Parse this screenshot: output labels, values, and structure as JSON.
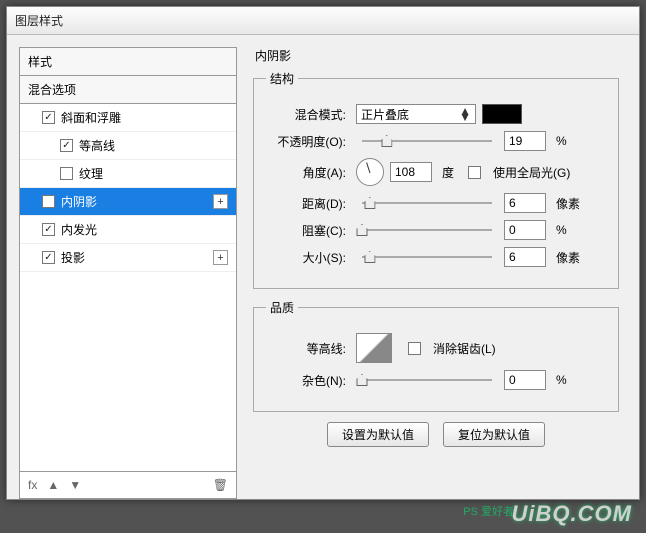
{
  "window": {
    "title": "图层样式"
  },
  "left": {
    "styles_header": "样式",
    "blend_options": "混合选项",
    "items": {
      "bevel": {
        "label": "斜面和浮雕",
        "checked": true
      },
      "contour": {
        "label": "等高线",
        "checked": true
      },
      "texture": {
        "label": "纹理",
        "checked": false
      },
      "inner_shadow": {
        "label": "内阴影",
        "checked": true
      },
      "inner_glow": {
        "label": "内发光",
        "checked": true
      },
      "drop_shadow": {
        "label": "投影",
        "checked": true
      }
    },
    "footer": {
      "fx": "fx"
    }
  },
  "right": {
    "section_title": "内阴影",
    "structure": {
      "legend": "结构",
      "blend_mode": {
        "label": "混合模式:",
        "value": "正片叠底"
      },
      "opacity": {
        "label": "不透明度(O):",
        "value": "19",
        "unit": "%"
      },
      "angle": {
        "label": "角度(A):",
        "value": "108",
        "unit": "度",
        "global": "使用全局光(G)"
      },
      "distance": {
        "label": "距离(D):",
        "value": "6",
        "unit": "像素"
      },
      "choke": {
        "label": "阻塞(C):",
        "value": "0",
        "unit": "%"
      },
      "size": {
        "label": "大小(S):",
        "value": "6",
        "unit": "像素"
      }
    },
    "quality": {
      "legend": "品质",
      "contour": {
        "label": "等高线:",
        "antialias": "消除锯齿(L)"
      },
      "noise": {
        "label": "杂色(N):",
        "value": "0",
        "unit": "%"
      }
    },
    "buttons": {
      "default": "设置为默认值",
      "reset": "复位为默认值"
    }
  },
  "watermark": {
    "text": "UiBQ.COM",
    "sub": "PS 爱好者"
  }
}
